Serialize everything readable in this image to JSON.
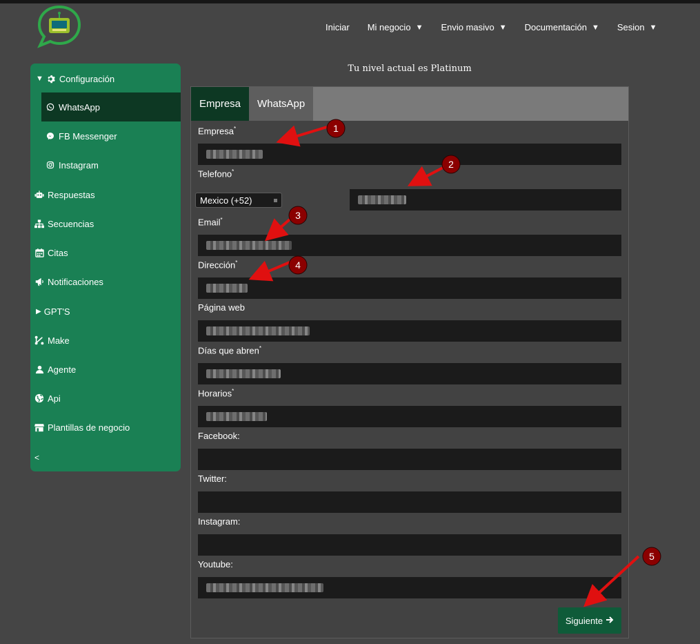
{
  "nav": {
    "items": [
      {
        "label": "Iniciar",
        "has_caret": false
      },
      {
        "label": "Mi negocio",
        "has_caret": true
      },
      {
        "label": "Envio masivo",
        "has_caret": true
      },
      {
        "label": "Documentación",
        "has_caret": true
      },
      {
        "label": "Sesion",
        "has_caret": true
      }
    ],
    "caret": "▼"
  },
  "sidebar": {
    "configuracion": "Configuración",
    "whatsapp": "WhatsApp",
    "fb_messenger": "FB Messenger",
    "instagram": "Instagram",
    "respuestas": "Respuestas",
    "secuencias": "Secuencias",
    "citas": "Citas",
    "notificaciones": "Notificaciones",
    "gpts": "GPT'S",
    "make": "Make",
    "agente": "Agente",
    "api": "Api",
    "plantillas": "Plantillas de negocio",
    "collapse": "<"
  },
  "level_text": "Tu nivel actual es Platinum",
  "tabs": {
    "empresa": "Empresa",
    "whatsapp": "WhatsApp"
  },
  "form": {
    "empresa_label": "Empresa",
    "telefono_label": "Telefono",
    "country_select": "Mexico (+52)",
    "email_label": "Email",
    "direccion_label": "Dirección",
    "pagina_label": "Página web",
    "dias_label": "Días que abren",
    "horarios_label": "Horarios",
    "facebook_label": "Facebook:",
    "twitter_label": "Twitter:",
    "instagram_label": "Instagram:",
    "youtube_label": "Youtube:",
    "required_mark": "*"
  },
  "buttons": {
    "siguiente": "Siguiente",
    "siguiente_arrow": "🡒"
  },
  "annotations": {
    "n1": "1",
    "n2": "2",
    "n3": "3",
    "n4": "4",
    "n5": "5"
  },
  "colors": {
    "brand_green": "#1a8054",
    "dark_green": "#0d3823",
    "arrow_red": "#e01010",
    "badge_red": "#8b0000"
  }
}
